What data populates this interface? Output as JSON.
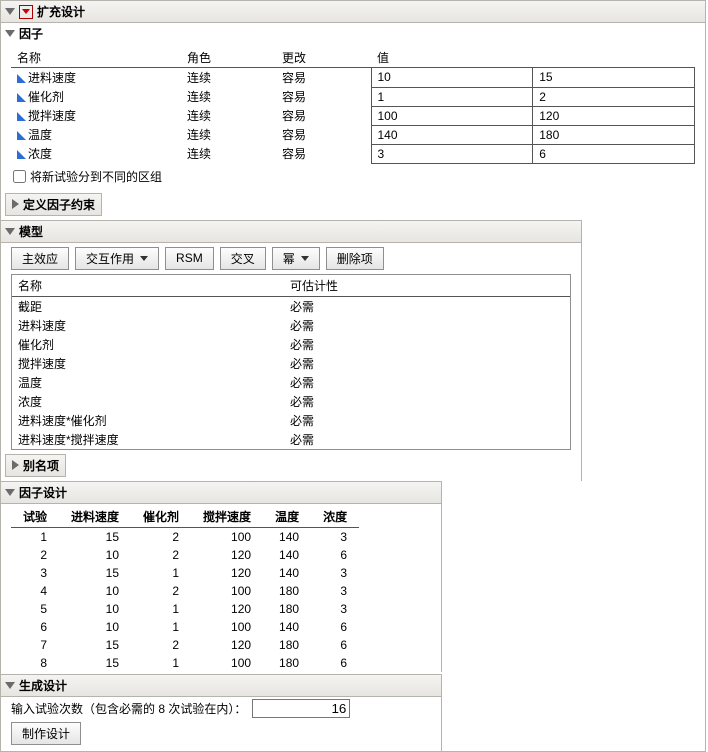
{
  "title": "扩充设计",
  "factors": {
    "title": "因子",
    "headers": [
      "名称",
      "角色",
      "更改",
      "值"
    ],
    "rows": [
      {
        "name": "进料速度",
        "role": "连续",
        "change": "容易",
        "low": "10",
        "high": "15"
      },
      {
        "name": "催化剂",
        "role": "连续",
        "change": "容易",
        "low": "1",
        "high": "2"
      },
      {
        "name": "搅拌速度",
        "role": "连续",
        "change": "容易",
        "low": "100",
        "high": "120"
      },
      {
        "name": "温度",
        "role": "连续",
        "change": "容易",
        "low": "140",
        "high": "180"
      },
      {
        "name": "浓度",
        "role": "连续",
        "change": "容易",
        "low": "3",
        "high": "6"
      }
    ],
    "block_label": "将新试验分到不同的区组"
  },
  "constraints": {
    "title": "定义因子约束"
  },
  "model": {
    "title": "模型",
    "buttons": {
      "main": "主效应",
      "inter": "交互作用",
      "rsm": "RSM",
      "cross": "交叉",
      "power": "幂",
      "remove": "删除项"
    },
    "headers": [
      "名称",
      "可估计性"
    ],
    "rows": [
      {
        "name": "截距",
        "est": "必需"
      },
      {
        "name": "进料速度",
        "est": "必需"
      },
      {
        "name": "催化剂",
        "est": "必需"
      },
      {
        "name": "搅拌速度",
        "est": "必需"
      },
      {
        "name": "温度",
        "est": "必需"
      },
      {
        "name": "浓度",
        "est": "必需"
      },
      {
        "name": "进料速度*催化剂",
        "est": "必需"
      },
      {
        "name": "进料速度*搅拌速度",
        "est": "必需"
      }
    ]
  },
  "alias": {
    "title": "别名项"
  },
  "design": {
    "title": "因子设计",
    "headers": [
      "试验",
      "进料速度",
      "催化剂",
      "搅拌速度",
      "温度",
      "浓度"
    ],
    "rows": [
      [
        1,
        15,
        2,
        100,
        140,
        3
      ],
      [
        2,
        10,
        2,
        120,
        140,
        6
      ],
      [
        3,
        15,
        1,
        120,
        140,
        3
      ],
      [
        4,
        10,
        2,
        100,
        180,
        3
      ],
      [
        5,
        10,
        1,
        120,
        180,
        3
      ],
      [
        6,
        10,
        1,
        100,
        140,
        6
      ],
      [
        7,
        15,
        2,
        120,
        180,
        6
      ],
      [
        8,
        15,
        1,
        100,
        180,
        6
      ]
    ]
  },
  "generate": {
    "title": "生成设计",
    "runs_label": "输入试验次数（包含必需的 8 次试验在内）：",
    "runs_value": "16",
    "make": "制作设计"
  }
}
